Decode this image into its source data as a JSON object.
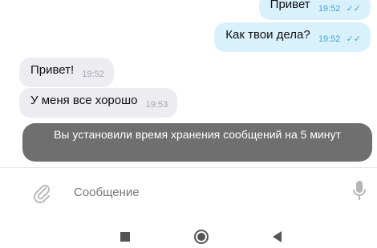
{
  "messages": [
    {
      "text": "Привет",
      "time": "19:52",
      "status": "✓✓"
    },
    {
      "text": "Как твои дела?",
      "time": "19:52",
      "status": "✓✓"
    },
    {
      "text": "Привет!",
      "time": "19:52"
    },
    {
      "text": "У меня все хорошо",
      "time": "19:53"
    }
  ],
  "system_notice": "Вы установили время хранения сообщений на 5 минут",
  "composer": {
    "placeholder": "Сообщение",
    "attach_icon": "paperclip-icon",
    "mic_icon": "microphone-icon"
  },
  "nav": {
    "recents_icon": "square-icon",
    "home_icon": "circle-icon",
    "back_icon": "triangle-back-icon"
  },
  "colors": {
    "outgoing_bubble": "#d9f1fd",
    "incoming_bubble": "#ececf1",
    "outgoing_meta": "#4aa3dd",
    "system_bubble": "#6f6f6f"
  }
}
